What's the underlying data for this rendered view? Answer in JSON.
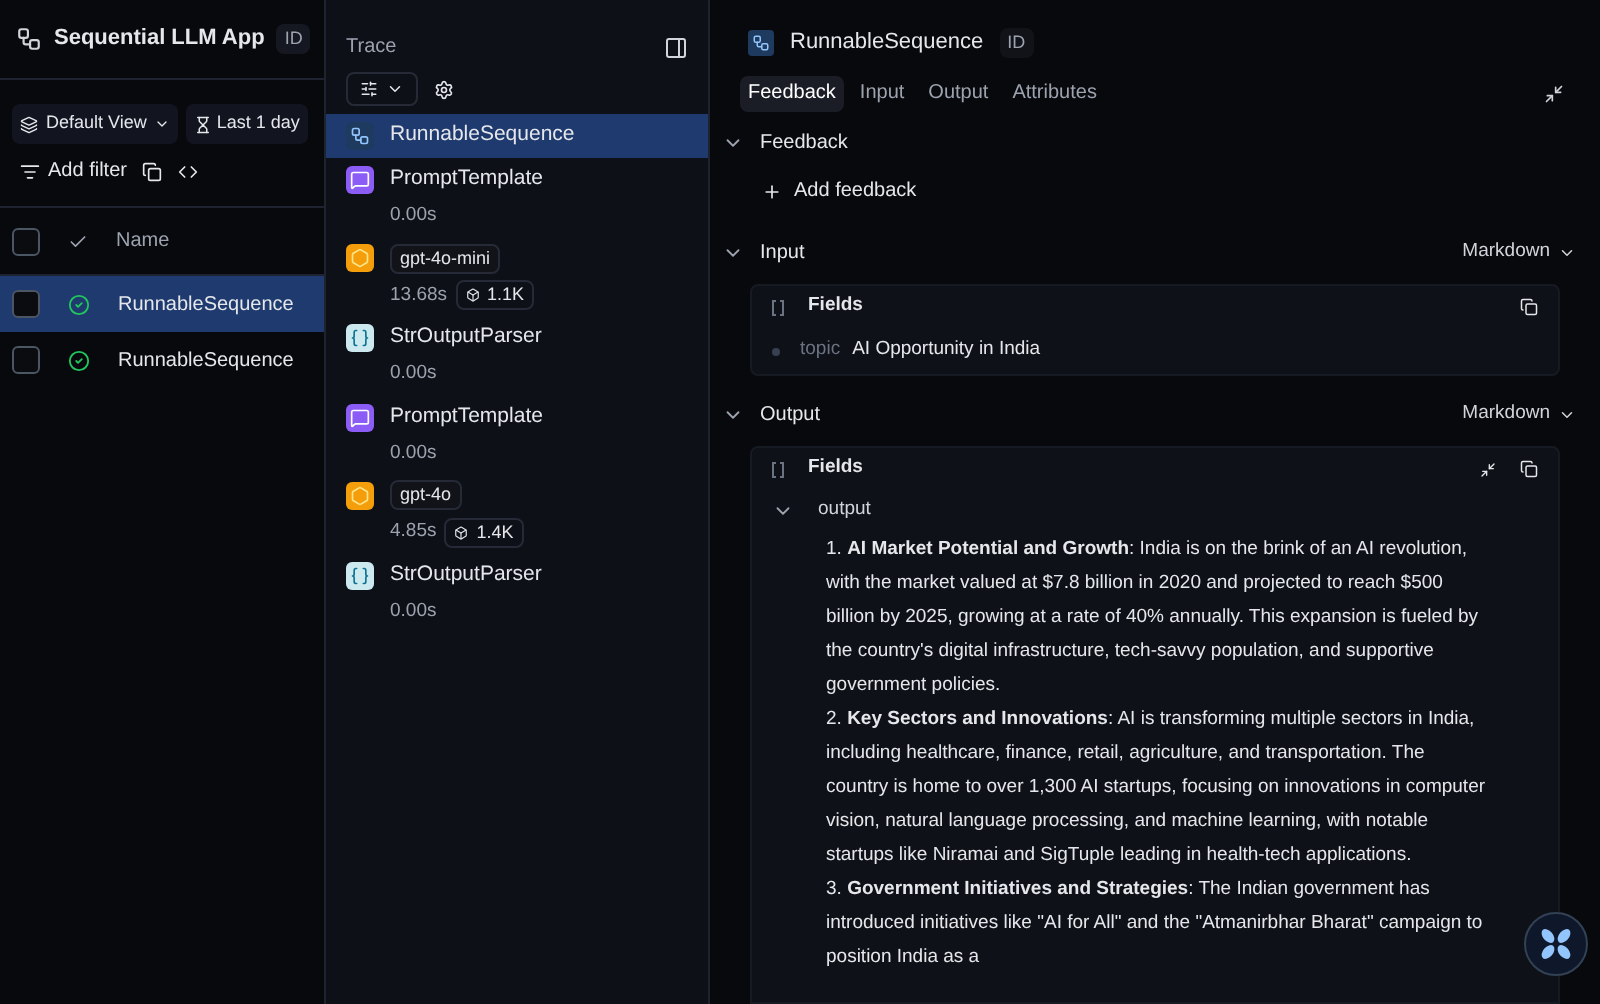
{
  "app": {
    "title": "Sequential LLM App",
    "id_badge": "ID"
  },
  "toolbar": {
    "view": "Default View",
    "time_range": "Last 1 day",
    "add_filter": "Add filter"
  },
  "table": {
    "header_checked": false,
    "columns": [
      {
        "label": "Name"
      }
    ],
    "rows": [
      {
        "name": "RunnableSequence",
        "checked": false,
        "selected": true
      },
      {
        "name": "RunnableSequence",
        "checked": false,
        "selected": false
      }
    ]
  },
  "trace": {
    "title": "Trace",
    "items": [
      {
        "kind": "chain",
        "name": "RunnableSequence",
        "selected": true
      },
      {
        "kind": "prompt",
        "name": "PromptTemplate",
        "duration": "0.00s",
        "selected": false
      },
      {
        "kind": "llm",
        "name": "gpt-4o-mini",
        "duration": "13.68s",
        "tokens": "1.1K",
        "selected": false
      },
      {
        "kind": "parser",
        "name": "StrOutputParser",
        "duration": "0.00s",
        "selected": false
      },
      {
        "kind": "prompt",
        "name": "PromptTemplate",
        "duration": "0.00s",
        "selected": false
      },
      {
        "kind": "llm",
        "name": "gpt-4o",
        "duration": "4.85s",
        "tokens": "1.4K",
        "selected": false
      },
      {
        "kind": "parser",
        "name": "StrOutputParser",
        "duration": "0.00s",
        "selected": false
      }
    ]
  },
  "detail": {
    "title": "RunnableSequence",
    "id_badge": "ID",
    "tabs": [
      {
        "label": "Feedback",
        "selected": true
      },
      {
        "label": "Input",
        "selected": false
      },
      {
        "label": "Output",
        "selected": false
      },
      {
        "label": "Attributes",
        "selected": false
      }
    ],
    "feedback": {
      "title": "Feedback",
      "expanded": true,
      "button": "Add feedback"
    },
    "input": {
      "title": "Input",
      "expanded": true,
      "format": "Markdown",
      "fields_title": "Fields",
      "fields": [
        {
          "key": "topic",
          "value": "AI Opportunity in India"
        }
      ]
    },
    "output": {
      "title": "Output",
      "expanded": true,
      "format": "Markdown",
      "fields_title": "Fields",
      "key": "output",
      "key_expanded": true,
      "items": [
        "1. **AI Market Potential and Growth**: India is on the brink of an AI revolution, with the market valued at $7.8 billion in 2020 and projected to reach $500 billion by 2025, growing at a rate of 40% annually. This expansion is fueled by the country's digital infrastructure, tech-savvy population, and supportive government policies.",
        "2. **Key Sectors and Innovations**: AI is transforming multiple sectors in India, including healthcare, finance, retail, agriculture, and transportation. The country is home to over 1,300 AI startups, focusing on innovations in computer vision, natural language processing, and machine learning, with notable startups like Niramai and SigTuple leading in health-tech applications.",
        "3. **Government Initiatives and Strategies**: The Indian government has introduced initiatives like \"AI for All\" and the \"Atmanirbhar Bharat\" campaign to position India as a"
      ]
    }
  }
}
